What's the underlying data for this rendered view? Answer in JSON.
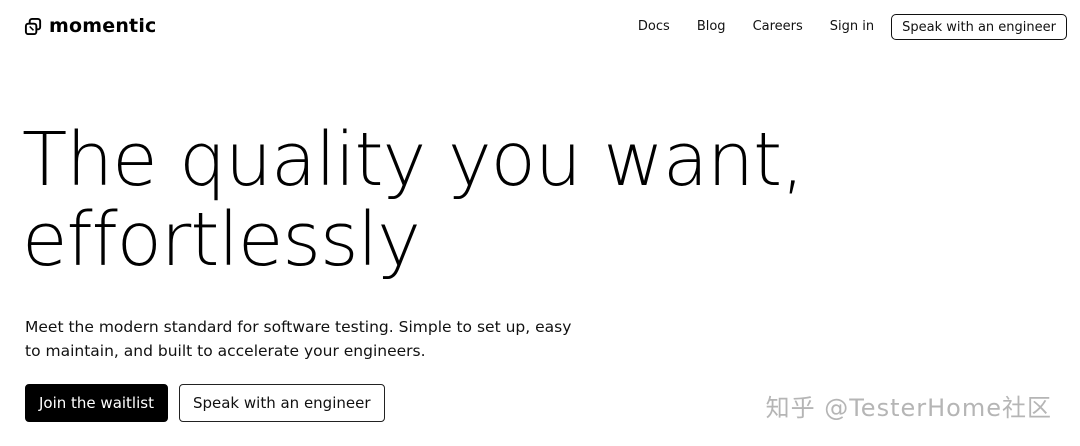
{
  "brand": {
    "name": "momentic",
    "icon": "momentic-logo-icon"
  },
  "nav": {
    "links": [
      "Docs",
      "Blog",
      "Careers",
      "Sign in"
    ],
    "cta_label": "Speak with an engineer"
  },
  "hero": {
    "title_line1": "The quality you want,",
    "title_line2": "effortlessly",
    "subtitle_line1": "Meet the modern standard for software testing. Simple to set up, easy",
    "subtitle_line2": "to maintain, and built to accelerate your engineers.",
    "primary_button": "Join the waitlist",
    "secondary_button": "Speak with an engineer"
  },
  "watermark": "知乎 @TesterHome社区",
  "colors": {
    "background": "#ffffff",
    "text": "#000000",
    "primary_button_bg": "#000000",
    "primary_button_text": "#ffffff"
  }
}
